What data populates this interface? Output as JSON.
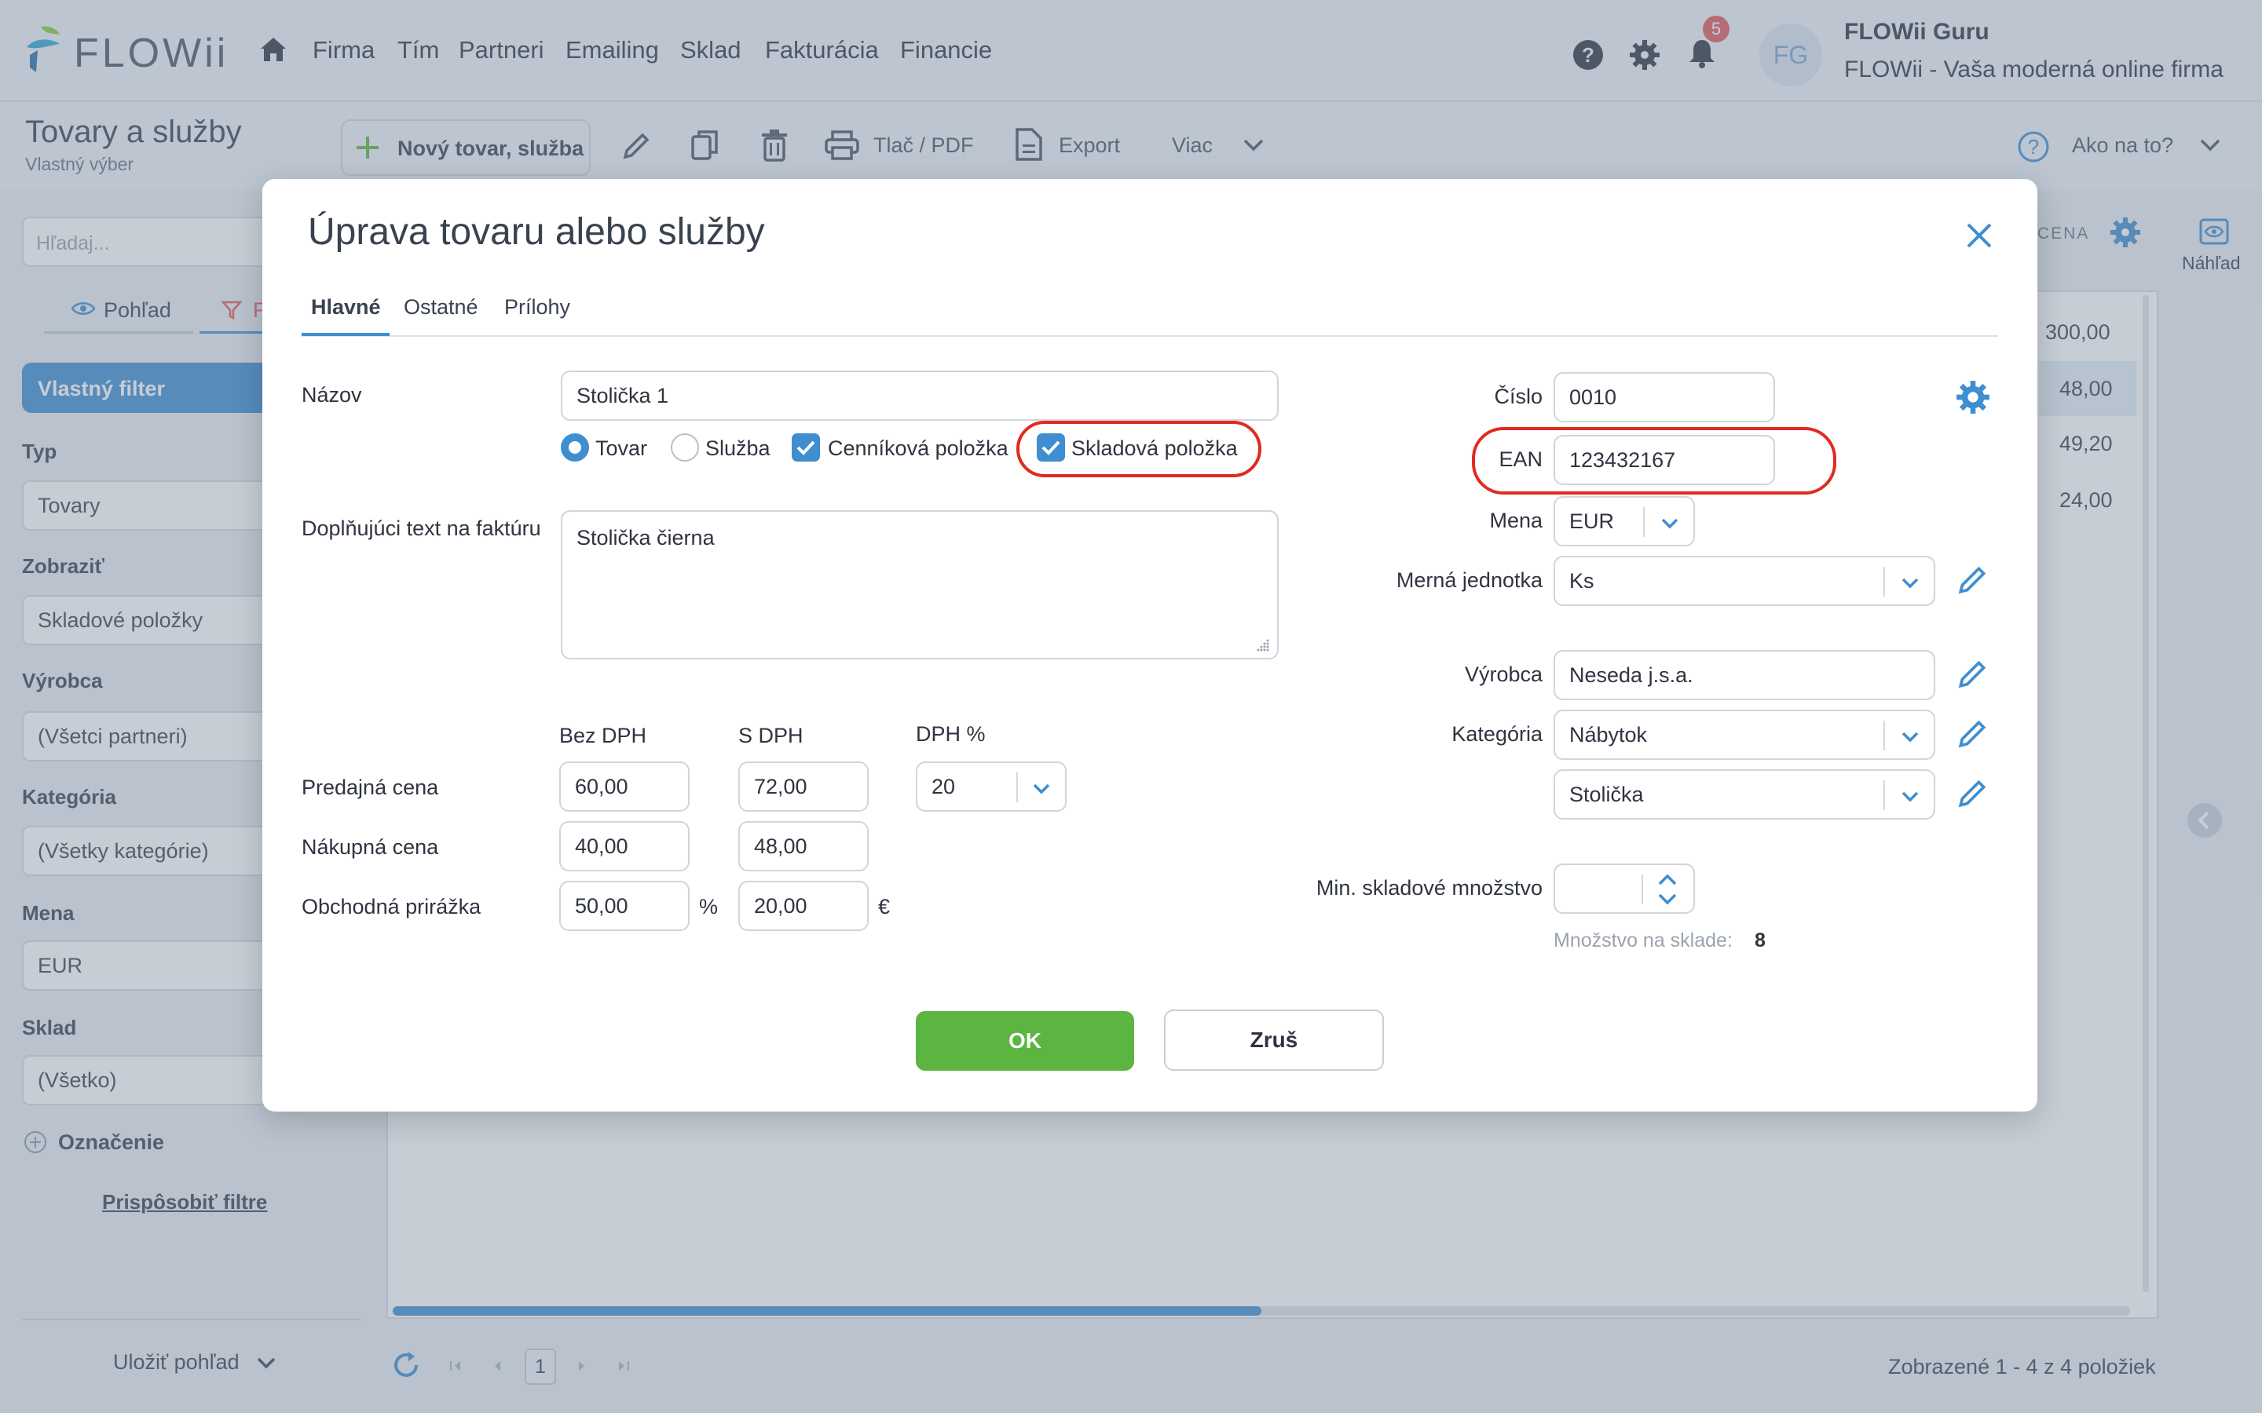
{
  "app": {
    "logo": "FLOWii",
    "nav": [
      "Firma",
      "Tím",
      "Partneri",
      "Emailing",
      "Sklad",
      "Fakturácia",
      "Financie"
    ],
    "notifications_count": "5",
    "avatar_initials": "FG",
    "user_name": "FLOWii Guru",
    "company_tagline": "FLOWii - Vaša moderná online firma"
  },
  "page": {
    "title": "Tovary a služby",
    "subtitle": "Vlastný výber"
  },
  "toolbar": {
    "new_item": "Nový tovar, služba",
    "print_pdf": "Tlač / PDF",
    "export": "Export",
    "more": "Viac",
    "help": "Ako na to?",
    "preview": "Náhľad"
  },
  "sidebar": {
    "search_placeholder": "Hľadaj...",
    "view_tab": "Pohľad",
    "filter_tab": "F",
    "custom_filter": "Vlastný filter",
    "groups": [
      {
        "label": "Typ",
        "value": "Tovary"
      },
      {
        "label": "Zobraziť",
        "value": "Skladové položky"
      },
      {
        "label": "Výrobca",
        "value": "(Všetci partneri)"
      },
      {
        "label": "Kategória",
        "value": "(Všetky kategórie)"
      },
      {
        "label": "Mena",
        "value": "EUR"
      },
      {
        "label": "Sklad",
        "value": "(Všetko)"
      }
    ],
    "marking": "Označenie",
    "customize_filters": "Prispôsobiť filtre",
    "save_view": "Uložiť pohľad"
  },
  "grid": {
    "column_header": "CENA",
    "values": [
      "300,00",
      "48,00",
      "49,20",
      "24,00"
    ],
    "page_number": "1",
    "footer": "Zobrazené 1 - 4 z 4 položiek",
    "scroll_fraction": 0.5
  },
  "modal": {
    "title": "Úprava tovaru alebo služby",
    "tabs": [
      "Hlavné",
      "Ostatné",
      "Prílohy"
    ],
    "name_label": "Názov",
    "name_value": "Stolička 1",
    "type_goods": "Tovar",
    "type_service": "Služba",
    "price_item": "Cenníková položka",
    "stock_item": "Skladová položka",
    "invoice_text_label": "Doplňujúci text na faktúru",
    "invoice_text_value": "Stolička čierna",
    "col_net": "Bez DPH",
    "col_gross": "S DPH",
    "col_vat": "DPH %",
    "sale_price_label": "Predajná cena",
    "sale_net": "60,00",
    "sale_gross": "72,00",
    "vat_value": "20",
    "purchase_price_label": "Nákupná cena",
    "purchase_net": "40,00",
    "purchase_gross": "48,00",
    "markup_label": "Obchodná prirážka",
    "markup_pct": "50,00",
    "pct_sign": "%",
    "markup_abs": "20,00",
    "euro_sign": "€",
    "number_label": "Číslo",
    "number_value": "0010",
    "ean_label": "EAN",
    "ean_value": "123432167",
    "currency_label": "Mena",
    "currency_value": "EUR",
    "unit_label": "Merná jednotka",
    "unit_value": "Ks",
    "manufacturer_label": "Výrobca",
    "manufacturer_value": "Neseda j.s.a.",
    "category_label": "Kategória",
    "category_value": "Nábytok",
    "subcategory_value": "Stolička",
    "min_stock_label": "Min. skladové množstvo",
    "stock_qty_label": "Množstvo na sklade:",
    "stock_qty_value": "8",
    "ok": "OK",
    "cancel": "Zruš"
  },
  "colors": {
    "accent": "#3e8ed0",
    "ok_green": "#5cb540",
    "highlight_red": "#e02a20",
    "badge_red": "#e05a5a"
  }
}
